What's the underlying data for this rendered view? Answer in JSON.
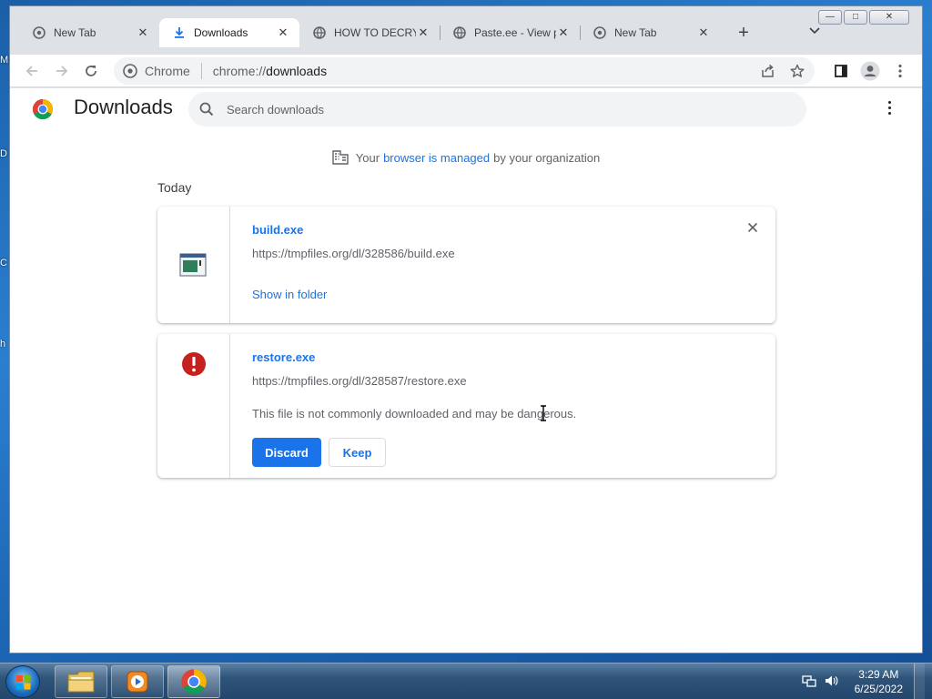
{
  "desktop": {
    "edge_letters": [
      "M",
      "D",
      "C",
      "h"
    ]
  },
  "window_controls": {
    "minimize": "—",
    "maximize": "□",
    "close": "✕"
  },
  "tabs": [
    {
      "title": "New Tab",
      "icon": "globe-icon",
      "active": false
    },
    {
      "title": "Downloads",
      "icon": "download-icon",
      "active": true
    },
    {
      "title": "HOW TO DECRYPT",
      "icon": "globe-icon",
      "active": false
    },
    {
      "title": "Paste.ee - View paste",
      "icon": "globe-icon",
      "active": false
    },
    {
      "title": "New Tab",
      "icon": "globe-icon",
      "active": false
    }
  ],
  "toolbar": {
    "chip_label": "Chrome",
    "url_scheme": "chrome://",
    "url_path": "downloads"
  },
  "page": {
    "title": "Downloads",
    "search_placeholder": "Search downloads",
    "managed": {
      "prefix": "Your",
      "link": "browser is managed",
      "suffix": "by your organization"
    },
    "date_heading": "Today"
  },
  "downloads": [
    {
      "file_name": "build.exe",
      "url": "https://tmpfiles.org/dl/328586/build.exe",
      "action_link": "Show in folder",
      "icon": "exe-file-icon"
    },
    {
      "file_name": "restore.exe",
      "url": "https://tmpfiles.org/dl/328587/restore.exe",
      "warning": "This file is not commonly downloaded and may be dangerous.",
      "discard_label": "Discard",
      "keep_label": "Keep",
      "icon": "danger-icon"
    }
  ],
  "taskbar": {
    "time": "3:29 AM",
    "date": "6/25/2022"
  },
  "colors": {
    "accent": "#1a73e8",
    "danger": "#c5221f",
    "tab_strip": "#dee1e6"
  }
}
